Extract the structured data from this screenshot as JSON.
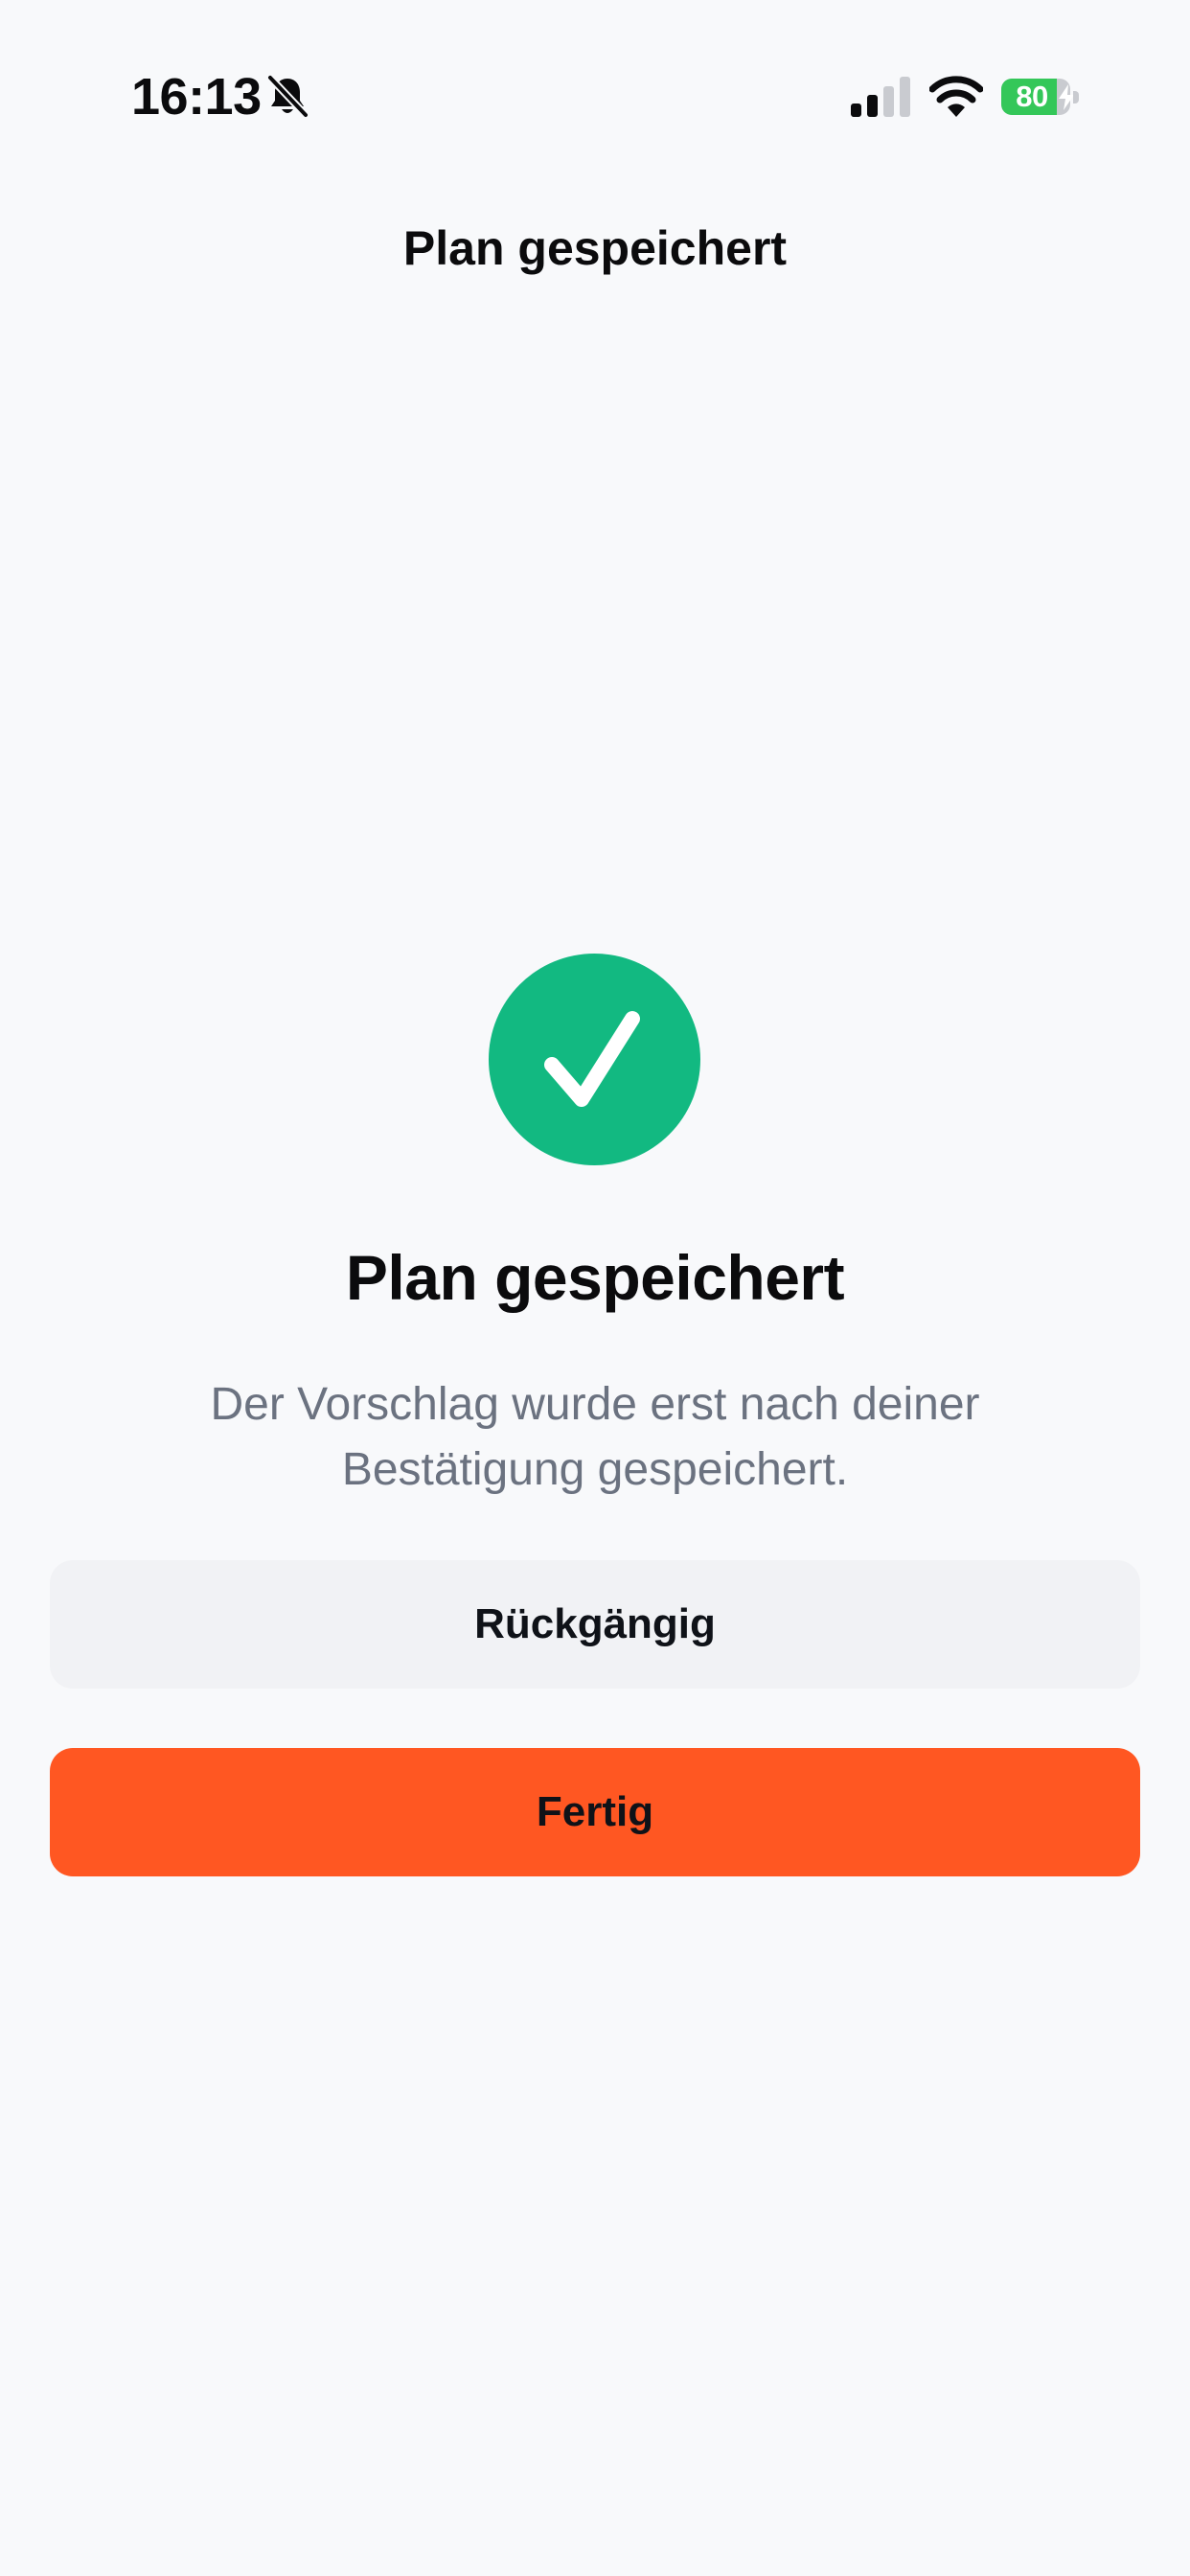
{
  "status_bar": {
    "time": "16:13",
    "bell_icon": "bell-slash-icon",
    "signal_icon": "cellular-signal-icon",
    "wifi_icon": "wifi-icon",
    "battery_level": "80",
    "battery_percent": 80,
    "battery_charging": true,
    "battery_color": "#34c759"
  },
  "header": {
    "title": "Plan gespeichert"
  },
  "main": {
    "icon": "checkmark-icon",
    "icon_color": "#12b981",
    "heading": "Plan gespeichert",
    "message": "Der Vorschlag wurde erst nach deiner Bestätigung gespeichert.",
    "undo_label": "Rückgängig",
    "done_label": "Fertig",
    "accent_color": "#ff5722"
  }
}
